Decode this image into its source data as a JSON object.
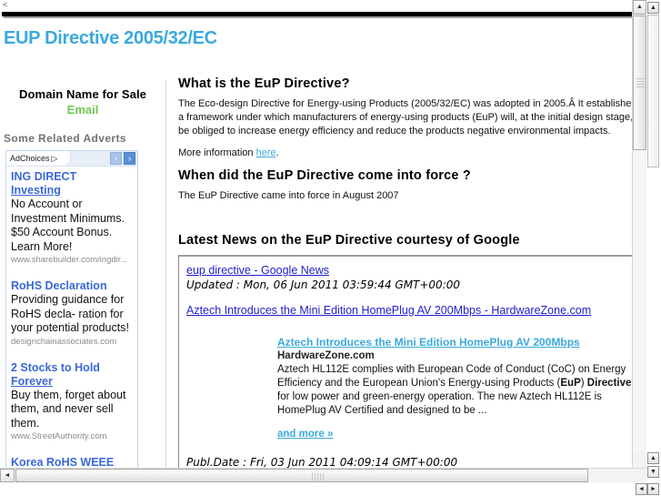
{
  "page": {
    "title": "EUP Directive 2005/32/EC",
    "corner_glyph": "<"
  },
  "sidebar": {
    "domain_for_sale": "Domain Name for Sale",
    "email_link": "Email",
    "related_adverts_heading": "Some Related Adverts",
    "adchoices_label": "AdChoices",
    "adchoices_triangle": "▷",
    "nav_prev": "‹",
    "nav_next": "›",
    "ads": [
      {
        "title_line1": "ING DIRECT",
        "title_line2": "Investing",
        "description": "No Account or Investment Minimums. $50 Account Bonus. Learn More!",
        "url": "www.sharebuilder.com/ingdir..."
      },
      {
        "title_line1": "RoHS Declaration",
        "title_line2": "",
        "description": "Providing guidance for RoHS decla- ration for your potential products!",
        "url": "designchainassociates.com"
      },
      {
        "title_line1": "2 Stocks to Hold",
        "title_line2": "Forever",
        "description": "Buy them, forget about them, and never sell them.",
        "url": "www.StreetAuthority.com"
      },
      {
        "title_line1": "Korea RoHS WEEE",
        "title_line2": "",
        "description": "",
        "url": ""
      }
    ]
  },
  "content": {
    "section1_heading": "What is the EuP Directive?",
    "section1_body": "The Eco-design Directive for Energy-using Products (2005/32/EC) was adopted in 2005.Â  It establishes a framework under which manufacturers of energy-using products (EuP) will, at the initial design stage, be obliged to increase energy efficiency and reduce the products negative environmental impacts.",
    "more_info_prefix": "More information ",
    "more_info_link": "here",
    "more_info_suffix": ".",
    "section2_heading": "When did the EuP Directive come into force ?",
    "section2_body": "The EuP Directive came into force in August 2007",
    "news_heading": "Latest News on the EuP Directive courtesy of Google"
  },
  "news": {
    "feed_title": "eup directive - Google News",
    "feed_updated": "Updated : Mon, 06 Jun 2011 03:59:44 GMT+00:00",
    "item_link": "Aztech Introduces the Mini Edition HomePlug AV 200Mbps - HardwareZone.com",
    "detail_title": "Aztech Introduces the Mini Edition HomePlug AV 200Mbps",
    "detail_source": "HardwareZone.com",
    "detail_body_1": "Aztech HL112E complies with European Code of Conduct (CoC) on Energy Efficiency and the European Union's Energy-using Products (",
    "detail_bold_1": "EuP",
    "detail_body_2": ") ",
    "detail_bold_2": "Directive",
    "detail_body_3": " for low power and green-energy operation. The new Aztech HL112E is HomePlug AV Certified and designed to be ...",
    "more_link": "and more »",
    "publ_date": "Publ.Date : Fri, 03 Jun 2011 04:09:14 GMT+00:00"
  },
  "scrollbars": {
    "arrow_up": "▲",
    "arrow_down": "▼",
    "arrow_left": "◄",
    "arrow_right": "►"
  },
  "colors": {
    "title_blue": "#3aa9dd",
    "email_green": "#6ec74e",
    "ad_link_blue": "#3a68d8",
    "news_link_blue": "#2020cc"
  }
}
